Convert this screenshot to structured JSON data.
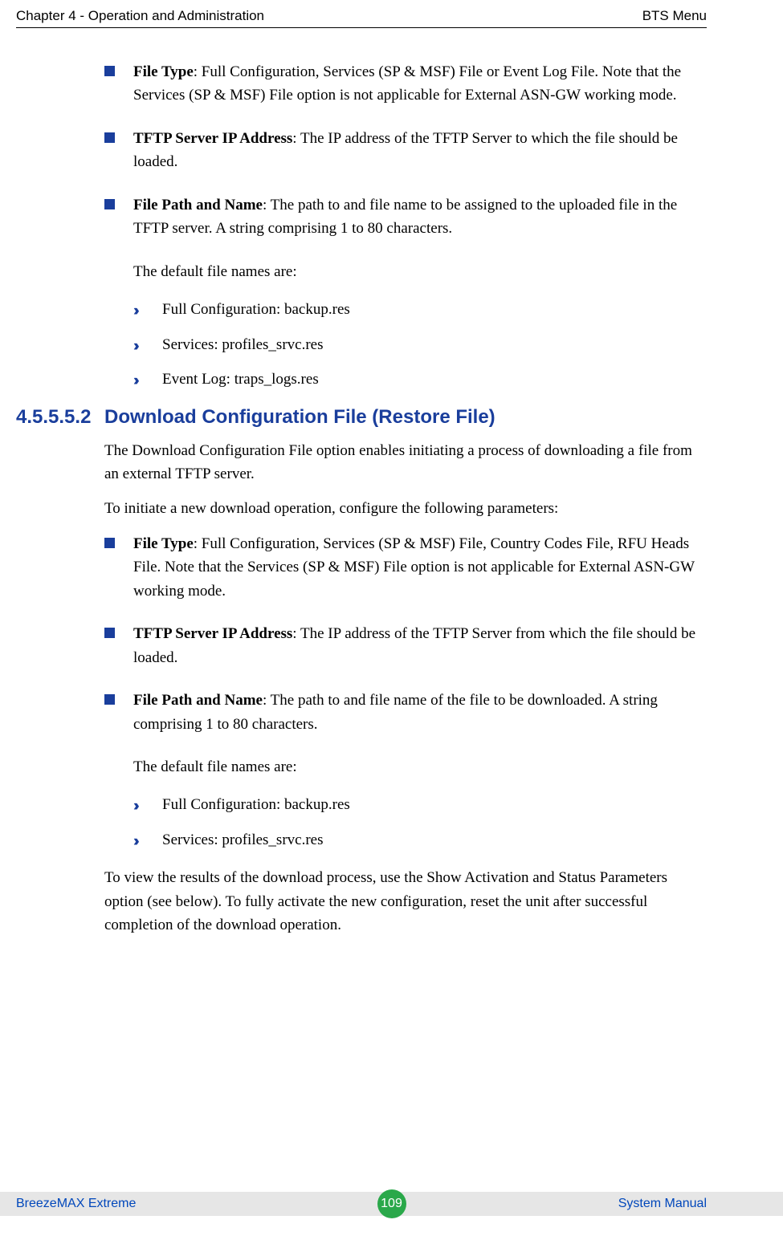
{
  "header": {
    "left": "Chapter 4 - Operation and Administration",
    "right": "BTS Menu"
  },
  "upload": {
    "items": [
      {
        "term": "File Type",
        "text": ": Full Configuration, Services (SP & MSF) File or Event Log File. Note that the Services (SP & MSF) File option is not applicable for External ASN-GW working mode."
      },
      {
        "term": "TFTP Server IP Address",
        "text": ": The IP address of the TFTP Server to which the file should be loaded."
      },
      {
        "term": "File Path and Name",
        "text": ": The path to and file name to be assigned to the uploaded file in the TFTP server. A string comprising 1 to 80 characters."
      }
    ],
    "defaults_lead": "The default file names are:",
    "defaults": [
      "Full Configuration: backup.res",
      "Services: profiles_srvc.res",
      "Event Log: traps_logs.res"
    ]
  },
  "section": {
    "number": "4.5.5.5.2",
    "title": "Download Configuration File (Restore File)",
    "intro1": "The Download Configuration File option enables initiating a process of downloading a file from an external TFTP server.",
    "intro2": "To initiate a new download operation, configure the following parameters:",
    "items": [
      {
        "term": "File Type",
        "text": ": Full Configuration, Services (SP & MSF) File, Country Codes File, RFU Heads File. Note that the Services (SP & MSF) File option is not applicable for External ASN-GW working mode."
      },
      {
        "term": "TFTP Server IP Address",
        "text": ": The IP address of the TFTP Server from which the file should be loaded."
      },
      {
        "term": "File Path and Name",
        "text": ": The path to and file name of the file to be downloaded. A string comprising 1 to 80 characters."
      }
    ],
    "defaults_lead": "The default file names are:",
    "defaults": [
      "Full Configuration: backup.res",
      "Services: profiles_srvc.res"
    ],
    "outro": "To view the results of the download process, use the Show Activation and Status Parameters option (see below). To fully activate the new configuration, reset the unit after successful completion of the download operation."
  },
  "footer": {
    "left": "BreezeMAX Extreme",
    "page": "109",
    "right": "System Manual"
  }
}
